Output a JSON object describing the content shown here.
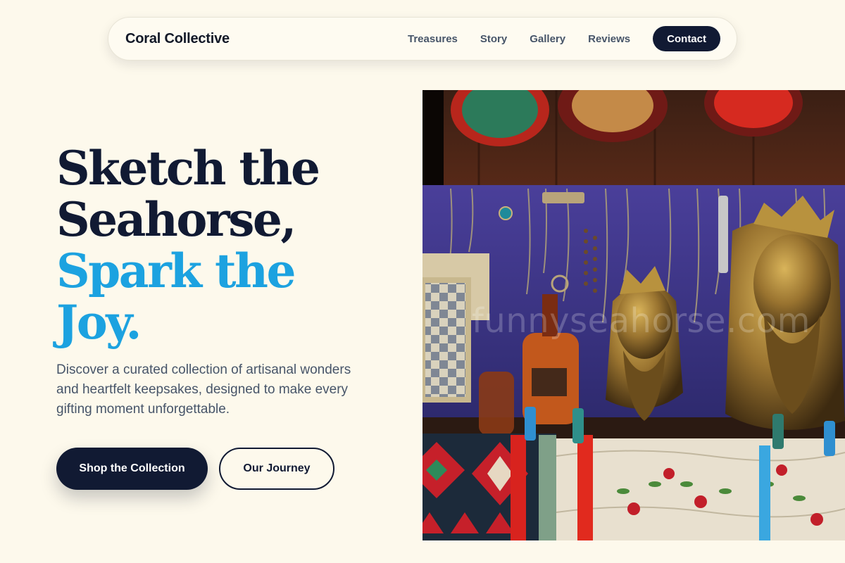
{
  "nav": {
    "brand": "Coral Collective",
    "links": [
      "Treasures",
      "Story",
      "Gallery",
      "Reviews"
    ],
    "cta": "Contact"
  },
  "hero": {
    "headline_line1": "Sketch the",
    "headline_line2": "Seahorse,",
    "headline_line3": "Spark the",
    "headline_line4": "Joy.",
    "description": "Discover a curated collection of artisanal wonders and heartfelt keepsakes, designed to make every gifting moment unforgettable.",
    "primary_button": "Shop the Collection",
    "secondary_button": "Our Journey",
    "image_watermark": "funnyseahorse.com"
  },
  "colors": {
    "background": "#fdf9ec",
    "dark": "#111a33",
    "accent": "#1ca2e0",
    "muted_text": "#475569"
  }
}
